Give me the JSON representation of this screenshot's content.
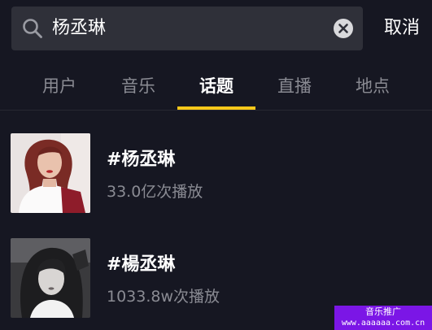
{
  "search": {
    "query": "杨丞琳",
    "cancel_label": "取消"
  },
  "tabs": [
    {
      "label": "用户",
      "active": false
    },
    {
      "label": "音乐",
      "active": false
    },
    {
      "label": "话题",
      "active": true
    },
    {
      "label": "直播",
      "active": false
    },
    {
      "label": "地点",
      "active": false
    }
  ],
  "results": [
    {
      "title": "#杨丞琳",
      "meta": "33.0亿次播放"
    },
    {
      "title": "#楊丞琳",
      "meta": "1033.8w次播放"
    }
  ],
  "ad_badge": {
    "title": "音乐推广",
    "url": "www.aaaaaa.com.cn"
  },
  "colors": {
    "background": "#161722",
    "search_bg": "#2f3039",
    "tab_indicator": "#f8c81a",
    "ad_badge": "#7b16e6"
  },
  "icons": [
    "search-icon",
    "clear-icon"
  ]
}
